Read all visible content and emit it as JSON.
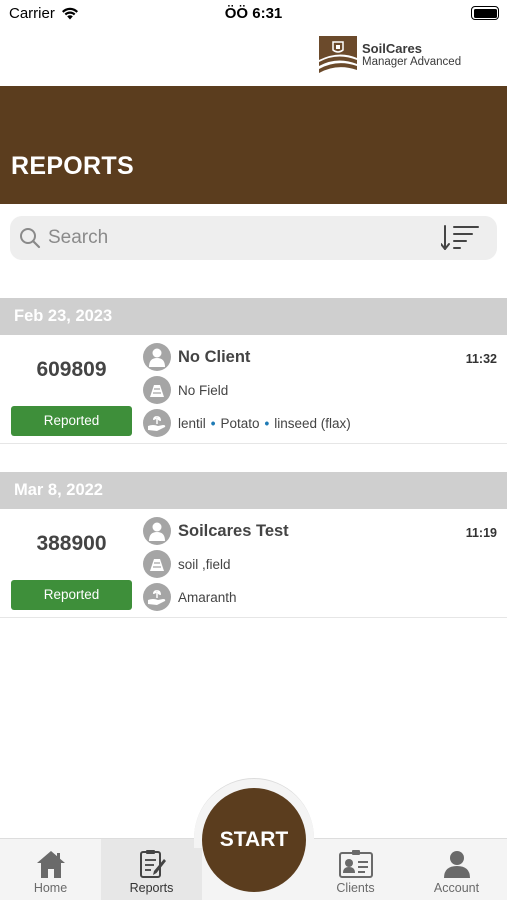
{
  "status_bar": {
    "carrier": "Carrier",
    "time": "ÖÖ 6:31"
  },
  "brand": {
    "name": "SoilCares",
    "subtitle": "Manager Advanced"
  },
  "header": {
    "title": "REPORTS"
  },
  "search": {
    "placeholder": "Search"
  },
  "sections": [
    {
      "date": "Feb 23, 2023",
      "report": {
        "id": "609809",
        "status": "Reported",
        "client": "No Client",
        "field": "No Field",
        "crops": [
          "lentil",
          "Potato",
          "linseed (flax)"
        ],
        "crop_separator": "•",
        "time": "11:32"
      }
    },
    {
      "date": "Mar 8, 2022",
      "report": {
        "id": "388900",
        "status": "Reported",
        "client": "Soilcares Test",
        "field": "soil ,field",
        "crops": [
          "Amaranth"
        ],
        "crop_separator": "•",
        "time": "11:19"
      }
    }
  ],
  "tabs": [
    {
      "label": "Home",
      "icon": "home-icon",
      "active": false
    },
    {
      "label": "Reports",
      "icon": "reports-icon",
      "active": true
    },
    {
      "label": "Clients",
      "icon": "clients-icon",
      "active": false
    },
    {
      "label": "Account",
      "icon": "account-icon",
      "active": false
    }
  ],
  "start_button": {
    "label": "START"
  },
  "colors": {
    "brand_brown": "#5b3d1e",
    "status_green": "#3e8f3a",
    "date_header_gray": "#cfcfcf",
    "crop_dot_blue": "#1f7bb5"
  }
}
